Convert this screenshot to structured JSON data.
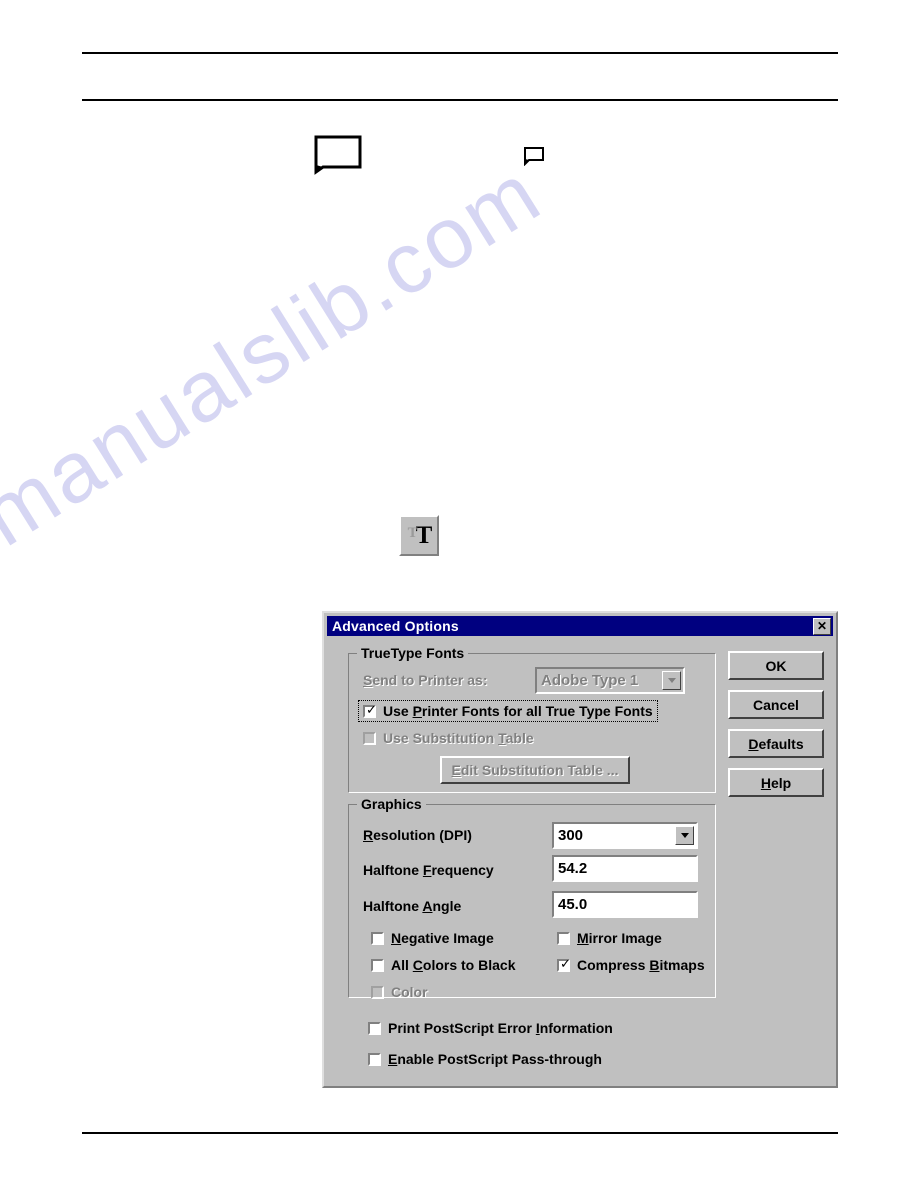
{
  "page": {
    "watermark_text": "manualslib.com",
    "watermark_color": "#c9c9ef",
    "doc_icon_name": "document-page-icon"
  },
  "truetype_button": {
    "glyph_small": "T",
    "glyph_large": "T",
    "name": "truetype-font-icon"
  },
  "dialog": {
    "title": "Advanced Options",
    "close_label": "✕",
    "titlebar_color": "#000080",
    "face_color": "#c0c0c0",
    "buttons": [
      {
        "id": "ok",
        "label": "OK",
        "underline": "",
        "enabled": true
      },
      {
        "id": "cancel",
        "label": "Cancel",
        "underline": "",
        "enabled": true
      },
      {
        "id": "defaults",
        "label": "Defaults",
        "underline": "D",
        "enabled": true
      },
      {
        "id": "help",
        "label": "Help",
        "underline": "H",
        "enabled": true
      }
    ],
    "truetype_group": {
      "legend": "TrueType Fonts",
      "send_to_printer_label": "Send to Printer as:",
      "send_to_printer_underline": "S",
      "send_to_printer_value": "Adobe Type 1",
      "send_to_printer_enabled": false,
      "checkboxes": [
        {
          "id": "use-printer-fonts",
          "label": "Use Printer Fonts for all True Type Fonts",
          "underline": "P",
          "checked": true,
          "enabled": true,
          "focused": true
        },
        {
          "id": "use-substitution-table",
          "label": "Use Substitution Table",
          "underline": "T",
          "checked": false,
          "enabled": false,
          "focused": false
        }
      ],
      "edit_table_button": {
        "label": "Edit Substitution Table ...",
        "underline": "E",
        "enabled": false
      }
    },
    "graphics_group": {
      "legend": "Graphics",
      "fields": [
        {
          "id": "resolution",
          "label": "Resolution (DPI)",
          "underline": "R",
          "value": "300",
          "type": "combo"
        },
        {
          "id": "halftone-frequency",
          "label": "Halftone Frequency",
          "underline": "F",
          "value": "54.2",
          "type": "text"
        },
        {
          "id": "halftone-angle",
          "label": "Halftone Angle",
          "underline": "A",
          "value": "45.0",
          "type": "text"
        }
      ],
      "checkboxes": [
        {
          "id": "negative-image",
          "label": "Negative Image",
          "underline": "N",
          "checked": false,
          "enabled": true
        },
        {
          "id": "mirror-image",
          "label": "Mirror Image",
          "underline": "M",
          "checked": false,
          "enabled": true
        },
        {
          "id": "all-colors-black",
          "label": "All Colors to Black",
          "underline": "C",
          "checked": false,
          "enabled": true
        },
        {
          "id": "compress-bitmaps",
          "label": "Compress Bitmaps",
          "underline": "B",
          "checked": true,
          "enabled": true
        },
        {
          "id": "color",
          "label": "Color",
          "underline": "",
          "checked": false,
          "enabled": false
        }
      ]
    },
    "footer_checkboxes": [
      {
        "id": "print-ps-error-info",
        "label": "Print PostScript Error Information",
        "underline": "I",
        "checked": false,
        "enabled": true
      },
      {
        "id": "enable-ps-passthru",
        "label": "Enable PostScript Pass-through",
        "underline": "E",
        "checked": false,
        "enabled": true
      }
    ]
  }
}
